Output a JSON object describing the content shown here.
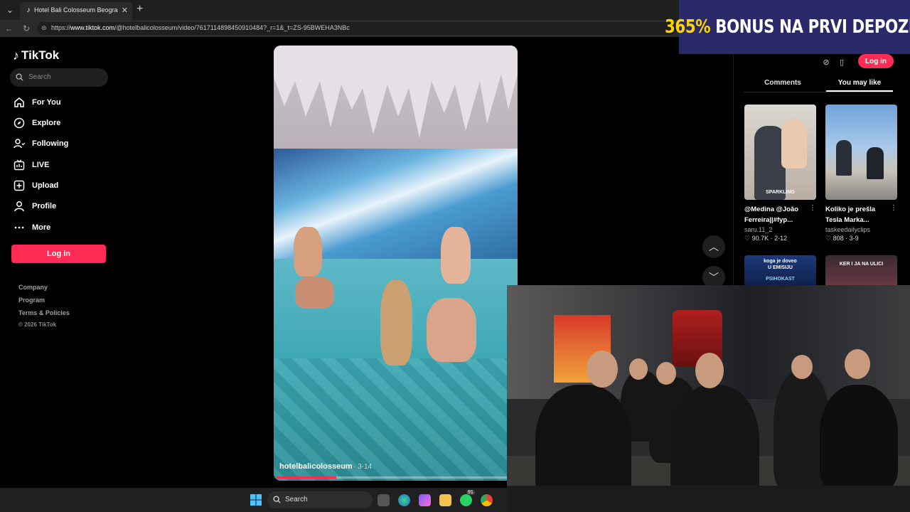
{
  "browser": {
    "tab_title": "Hotel Bali Colosseum Beograd (@h",
    "url_prefix": "https://",
    "url_host": "www.tiktok.com",
    "url_path": "/@hotelbalicolosseum/video/7617114898450910484?_r=1&_t=ZS-95BWEHA3NBc"
  },
  "ad": {
    "accent": "365%",
    "text": " BONUS NA PRVI DEPOZIT"
  },
  "tiktok": {
    "logo": "TikTok",
    "search_placeholder": "Search",
    "nav": [
      {
        "label": "For You",
        "icon": "home-icon"
      },
      {
        "label": "Explore",
        "icon": "compass-icon"
      },
      {
        "label": "Following",
        "icon": "following-icon"
      },
      {
        "label": "LIVE",
        "icon": "live-icon"
      },
      {
        "label": "Upload",
        "icon": "upload-icon"
      },
      {
        "label": "Profile",
        "icon": "profile-icon"
      },
      {
        "label": "More",
        "icon": "more-icon"
      }
    ],
    "login_label": "Log in",
    "footer": {
      "company": "Company",
      "program": "Program",
      "terms": "Terms & Policies",
      "copyright": "© 2026 TikTok"
    }
  },
  "video": {
    "author": "hotelbalicolosseum",
    "date": "· 3-14",
    "progress": 0.25
  },
  "right_panel": {
    "login_label": "Log in",
    "tabs": {
      "comments": "Comments",
      "you_may_like": "You may like"
    },
    "cards": [
      {
        "caption1": "@Medina @João",
        "caption2": "Ferreira||#fyp...",
        "user": "saru.11_2",
        "likes": "♡ 90.7K",
        "date": "· 2-12"
      },
      {
        "caption1": "Koliko je prešla",
        "caption2": "Tesla Marka...",
        "user": "taskeedailyclips",
        "likes": "♡ 808",
        "date": "· 3-9"
      }
    ],
    "thumb_texts": {
      "card1_bottom": "SPARKLING",
      "card3": "koga je doveo\nU EMISIJU",
      "card3_sub": "PSIHOKAST",
      "card4": "KER I JA NA ULICI"
    }
  },
  "taskbar": {
    "search_label": "Search",
    "badge": "91"
  }
}
